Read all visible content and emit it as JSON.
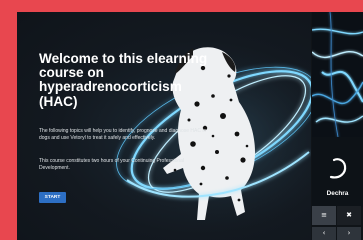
{
  "course": {
    "title": "Welcome to this elearning course on hyperadrenocorticism (HAC)",
    "intro": "The following topics will help you to identify, prognose and diagnose HAC in dogs and use Vetoryl to treat it safely and effectively.",
    "cpd_note": "This course constitutes two hours of your Continuing Professional Development.",
    "start_label": "START"
  },
  "sidebar": {
    "brand_name": "Dechra",
    "brand_logo_icon": "dechra-swirl-logo-icon",
    "menu_icon": "hamburger-menu-icon",
    "menu_glyph": "≡",
    "close_icon": "close-icon",
    "close_glyph": "✖",
    "prev_icon": "chevron-left-icon",
    "prev_glyph": "‹",
    "next_icon": "chevron-right-icon",
    "next_glyph": "›"
  },
  "colors": {
    "page_border": "#e8474f",
    "start_button": "#2d6fc4",
    "glow_ring": "#7fd8ff"
  }
}
